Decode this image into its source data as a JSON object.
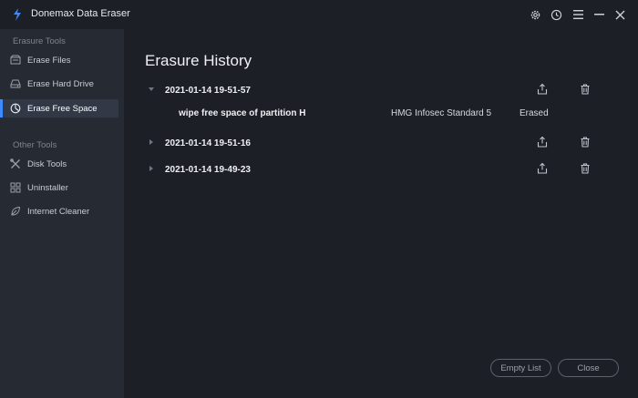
{
  "app": {
    "title": "Donemax Data Eraser",
    "accent": "#3d8bff"
  },
  "window_controls": [
    "gear-icon",
    "clock-icon",
    "menu-icon",
    "minimize-icon",
    "close-icon"
  ],
  "sidebar": {
    "sections": [
      {
        "title": "Erasure Tools",
        "items": [
          {
            "label": "Erase Files",
            "icon": "files-icon"
          },
          {
            "label": "Erase Hard Drive",
            "icon": "drive-icon"
          },
          {
            "label": "Erase Free Space",
            "icon": "clock-pie-icon",
            "active": true
          }
        ]
      },
      {
        "title": "Other Tools",
        "items": [
          {
            "label": "Disk Tools",
            "icon": "tools-icon"
          },
          {
            "label": "Uninstaller",
            "icon": "grid-icon"
          },
          {
            "label": "Internet Cleaner",
            "icon": "leaf-icon"
          }
        ]
      }
    ]
  },
  "main": {
    "title": "Erasure History",
    "history": [
      {
        "date": "2021-01-14 19-51-57",
        "expanded": true,
        "details": [
          {
            "name": "wipe free space of partition H",
            "algorithm": "HMG Infosec Standard 5",
            "status": "Erased"
          }
        ]
      },
      {
        "date": "2021-01-14 19-51-16",
        "expanded": false
      },
      {
        "date": "2021-01-14 19-49-23",
        "expanded": false
      }
    ],
    "buttons": {
      "empty_list": "Empty List",
      "close": "Close"
    }
  }
}
